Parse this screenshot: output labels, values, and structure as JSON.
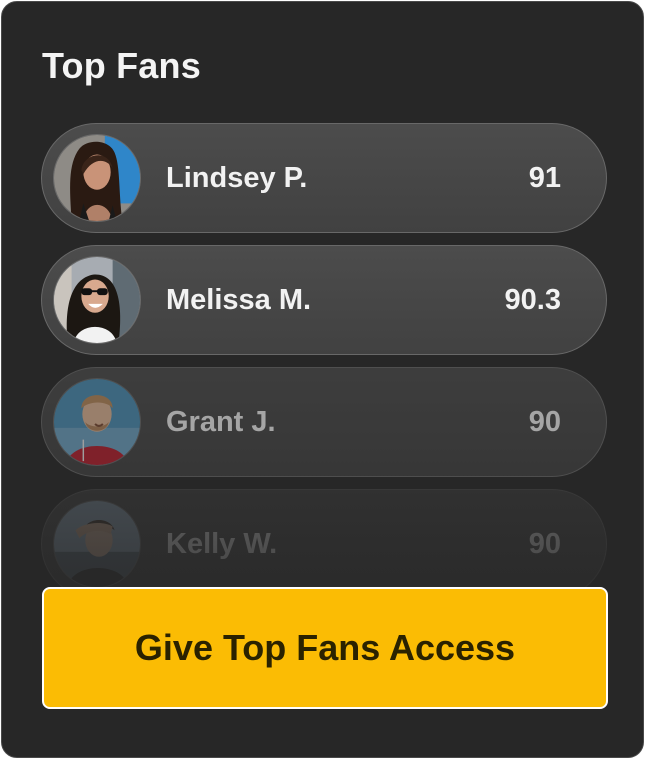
{
  "panel": {
    "title": "Top Fans"
  },
  "fans": [
    {
      "name": "Lindsey P.",
      "score": "91",
      "avatar_icon": "woman-long-dark-hair-avatar",
      "bg_color": "#2f86c9"
    },
    {
      "name": "Melissa M.",
      "score": "90.3",
      "avatar_icon": "woman-sunglasses-avatar",
      "bg_color": "#9aa0a8"
    },
    {
      "name": "Grant J.",
      "score": "90",
      "avatar_icon": "man-red-shirt-avatar",
      "bg_color": "#4b8fb5"
    },
    {
      "name": "Kelly W.",
      "score": "90",
      "avatar_icon": "person-hand-on-head-avatar",
      "bg_color": "#8fa5b8"
    }
  ],
  "cta": {
    "label": "Give Top Fans Access",
    "color": "#fbbc04"
  }
}
